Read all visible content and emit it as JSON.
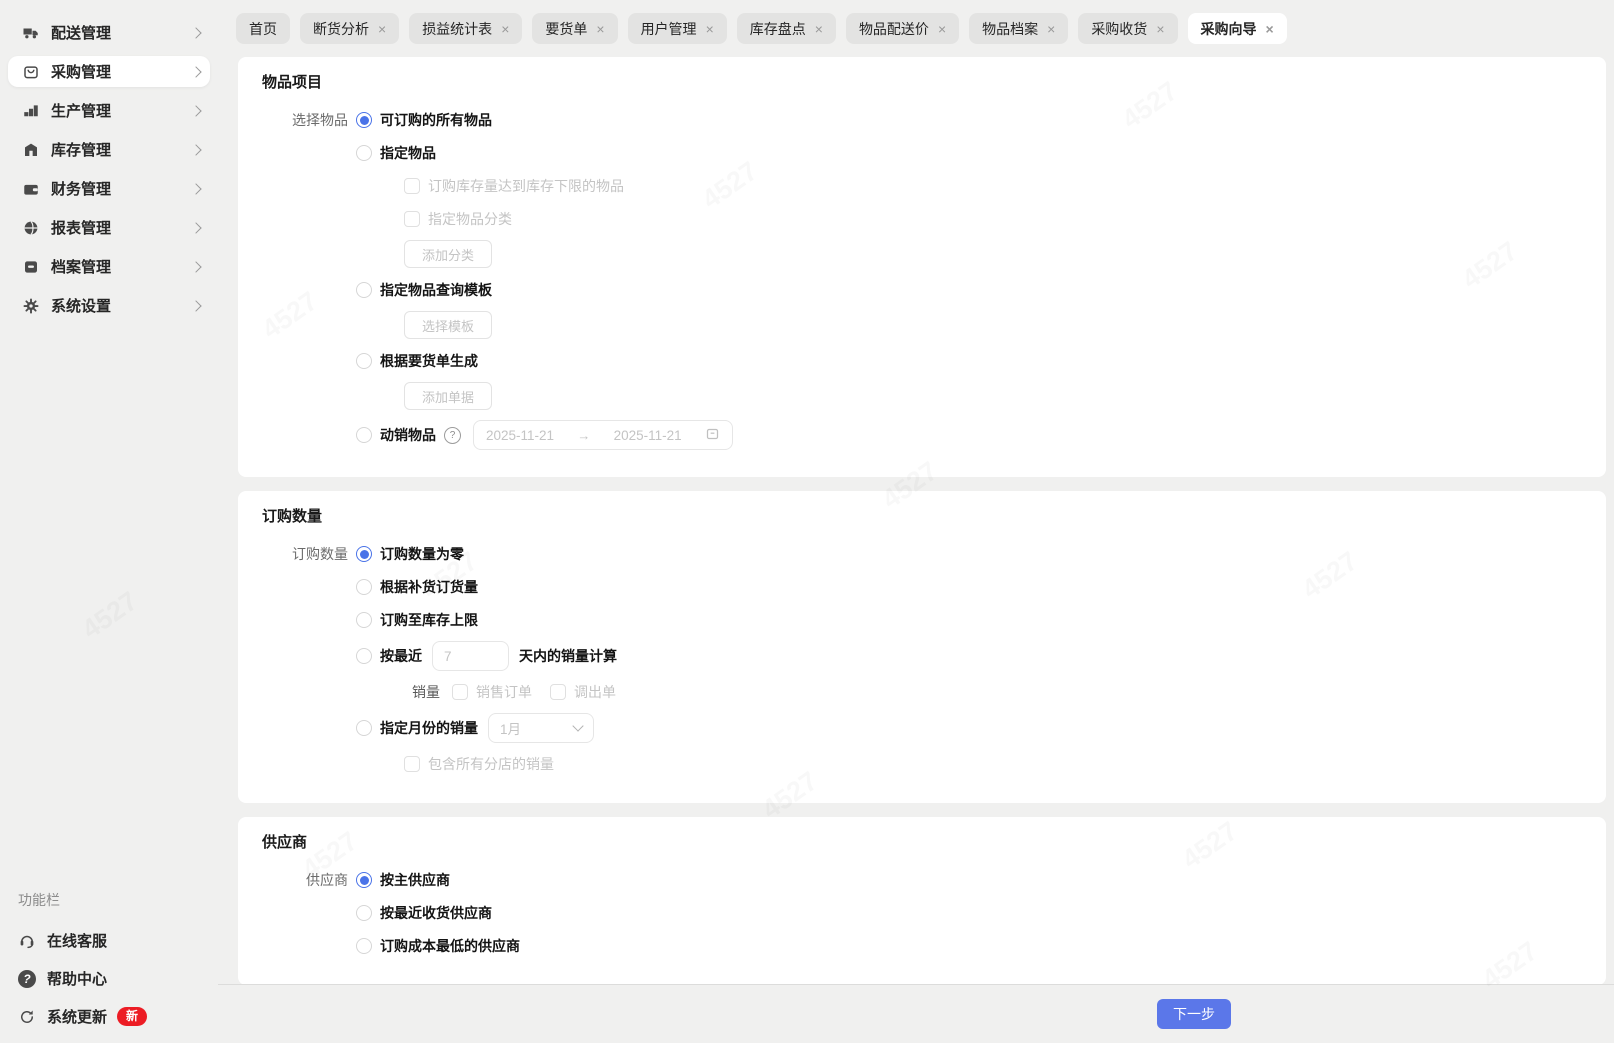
{
  "ui": {
    "close_glyph": "×",
    "question_glyph": "?",
    "arrow_glyph": "→",
    "colors": {
      "accent_blue": "#4a73e8",
      "button_blue": "#5b77e9",
      "badge_red": "#ec1c24"
    }
  },
  "watermark": "4527",
  "sidebar": {
    "items": [
      {
        "label": "配送管理",
        "icon": "delivery-truck-icon"
      },
      {
        "label": "采购管理",
        "icon": "purchase-box-icon",
        "active": true
      },
      {
        "label": "生产管理",
        "icon": "production-steps-icon"
      },
      {
        "label": "库存管理",
        "icon": "warehouse-icon"
      },
      {
        "label": "财务管理",
        "icon": "finance-wallet-icon"
      },
      {
        "label": "报表管理",
        "icon": "report-globe-icon"
      },
      {
        "label": "档案管理",
        "icon": "archive-box-icon"
      },
      {
        "label": "系统设置",
        "icon": "settings-gear-icon"
      }
    ],
    "footer_title": "功能栏",
    "footer_items": [
      {
        "label": "在线客服",
        "icon": "customer-service-icon"
      },
      {
        "label": "帮助中心",
        "icon": "help-circle-icon"
      },
      {
        "label": "系统更新",
        "icon": "refresh-icon",
        "badge": "新"
      }
    ]
  },
  "tabs": [
    {
      "label": "首页",
      "closable": false,
      "active": false
    },
    {
      "label": "断货分析",
      "closable": true,
      "active": false
    },
    {
      "label": "损益统计表",
      "closable": true,
      "active": false
    },
    {
      "label": "要货单",
      "closable": true,
      "active": false
    },
    {
      "label": "用户管理",
      "closable": true,
      "active": false
    },
    {
      "label": "库存盘点",
      "closable": true,
      "active": false
    },
    {
      "label": "物品配送价",
      "closable": true,
      "active": false
    },
    {
      "label": "物品档案",
      "closable": true,
      "active": false
    },
    {
      "label": "采购收货",
      "closable": true,
      "active": false
    },
    {
      "label": "采购向导",
      "closable": true,
      "active": true
    }
  ],
  "sections": [
    {
      "title": "物品项目",
      "field_label": "选择物品",
      "options": [
        {
          "label": "可订购的所有物品",
          "selected": true
        },
        {
          "label": "指定物品",
          "selected": false
        },
        {
          "label": "指定物品查询模板",
          "selected": false
        },
        {
          "label": "根据要货单生成",
          "selected": false
        },
        {
          "label": "动销物品",
          "selected": false,
          "has_help": true
        }
      ],
      "checkboxes": [
        "订购库存量达到库存下限的物品",
        "指定物品分类"
      ],
      "buttons": {
        "add_category": "添加分类",
        "select_template": "选择模板",
        "add_doc": "添加单据"
      },
      "date_range": {
        "start": "2025-11-21",
        "end": "2025-11-21"
      }
    },
    {
      "title": "订购数量",
      "field_label": "订购数量",
      "options": [
        {
          "label": "订购数量为零",
          "selected": true
        },
        {
          "label": "根据补货订货量",
          "selected": false
        },
        {
          "label": "订购至库存上限",
          "selected": false
        },
        {
          "prefix": "按最近",
          "input_placeholder": "7",
          "suffix": "天内的销量计算",
          "selected": false
        },
        {
          "label": "指定月份的销量",
          "select_value": "1月",
          "selected": false
        }
      ],
      "sales_row": {
        "label": "销量",
        "checkboxes": [
          "销售订单",
          "调出单"
        ]
      },
      "include_checkbox": "包含所有分店的销量"
    },
    {
      "title": "供应商",
      "field_label": "供应商",
      "options": [
        {
          "label": "按主供应商",
          "selected": true
        },
        {
          "label": "按最近收货供应商",
          "selected": false
        },
        {
          "label": "订购成本最低的供应商",
          "selected": false
        }
      ]
    }
  ],
  "footer": {
    "next": "下一步"
  }
}
